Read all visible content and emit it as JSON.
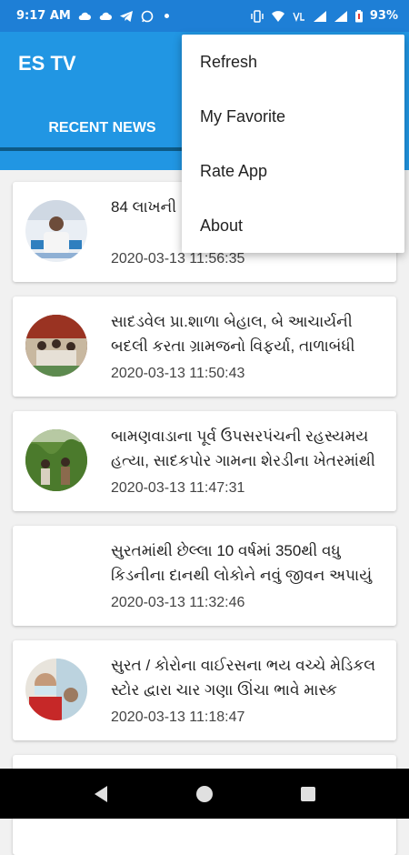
{
  "status_bar": {
    "time": "9:17 AM",
    "battery": "93%",
    "left_icons": [
      "cloud-icon",
      "cloud-icon",
      "telegram-icon",
      "whatsapp-icon"
    ],
    "right_icons": [
      "vibrate-icon",
      "wifi-icon",
      "volte-icon",
      "signal-icon",
      "signal-icon",
      "battery-icon"
    ]
  },
  "app": {
    "title": "ES TV",
    "accent": "#2196e3",
    "status_color": "#1e7fd6"
  },
  "tabs": [
    {
      "label": "RECENT NEWS",
      "selected": true
    }
  ],
  "menu": {
    "items": [
      "Refresh",
      "My Favorite",
      "Rate App",
      "About"
    ]
  },
  "news": [
    {
      "headline": "84 લાખની ... પાલિકા ઇજ...",
      "time": "2020-03-13 11:56:35",
      "has_thumb": true
    },
    {
      "headline": " સાદડવેલ પ્રા.શાળા બેહાલ, બે આચાર્યની બદલી કરતા ગ્રામજનો વિફર્યા, તાળાબંધી",
      "time": "2020-03-13 11:50:43",
      "has_thumb": true
    },
    {
      "headline": " બામણવાડાના પૂર્વ ઉપસરપંચની રહસ્યમય હત્યા, સાદકપોર ગામના શેરડીના ખેતરમાંથી",
      "time": "2020-03-13 11:47:31",
      "has_thumb": true
    },
    {
      "headline": "સુરતમાંથી છેલ્લા 10 વર્ષમાં 350થી વધુ કિડનીના દાનથી લોકોને નવું જીવન અપાયું",
      "time": "2020-03-13 11:32:46",
      "has_thumb": false
    },
    {
      "headline": "સુરત / કોરોના વાઈરસના ભય વચ્ચે મેડિકલ સ્ટોર દ્વારા ચાર ગણા ઊંચા ભાવે માસ્ક",
      "time": "2020-03-13 11:18:47",
      "has_thumb": true
    }
  ],
  "nav": [
    "back-icon",
    "home-icon",
    "recents-icon"
  ]
}
